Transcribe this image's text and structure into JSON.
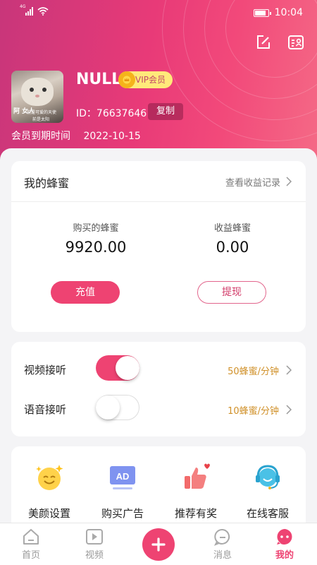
{
  "status_bar": {
    "network": "4G",
    "time": "10:04"
  },
  "profile": {
    "username": "NULL",
    "vip_label": "VIP会员",
    "id_text": "ID：76637646",
    "copy_label": "复制",
    "expire_label": "会员到期时间",
    "expire_date": "2022-10-15",
    "avatar_caption_left": "阿 女人",
    "avatar_caption_right": "前是可爱的天使",
    "avatar_caption_bottom": "前是太阳"
  },
  "honey": {
    "title": "我的蜂蜜",
    "records_link": "查看收益记录",
    "purchased_label": "购买的蜂蜜",
    "purchased_value": "9920.00",
    "earned_label": "收益蜂蜜",
    "earned_value": "0.00",
    "charge_label": "充值",
    "withdraw_label": "提现"
  },
  "listening": [
    {
      "label": "视频接听",
      "rate": "50蜂蜜/分钟",
      "enabled": true
    },
    {
      "label": "语音接听",
      "rate": "10蜂蜜/分钟",
      "enabled": false
    }
  ],
  "features": [
    {
      "label": "美颜设置",
      "icon": "beauty-smile-icon"
    },
    {
      "label": "购买广告",
      "icon": "ad-icon"
    },
    {
      "label": "推荐有奖",
      "icon": "thumbs-up-heart-icon"
    },
    {
      "label": "在线客服",
      "icon": "customer-service-icon"
    }
  ],
  "tabs": [
    {
      "label": "首页",
      "icon": "home-icon"
    },
    {
      "label": "视频",
      "icon": "video-icon"
    },
    {
      "label": "",
      "icon": "plus-icon"
    },
    {
      "label": "消息",
      "icon": "message-icon"
    },
    {
      "label": "我的",
      "icon": "profile-icon"
    }
  ],
  "colors": {
    "primary": "#ee4372",
    "gold": "#d09028",
    "vip_bg": "#ffe97a"
  }
}
